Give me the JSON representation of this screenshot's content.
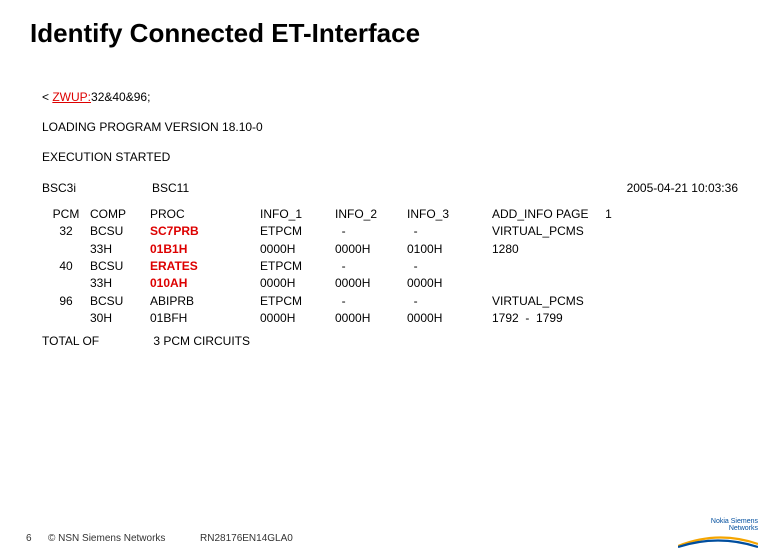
{
  "title": "Identify Connected ET-Interface",
  "cmd": {
    "prefix": "< ",
    "zwup": "ZWUP:",
    "args": "32&40&96;"
  },
  "line_loading": "LOADING PROGRAM VERSION 18.10-0",
  "line_exec": "EXECUTION STARTED",
  "meta": {
    "bsc3i": "BSC3i",
    "bsc11": "BSC11",
    "timestamp": "2005-04-21  10:03:36"
  },
  "headers": {
    "pcm": "PCM",
    "comp": "COMP",
    "proc": "PROC",
    "info1": "INFO_1",
    "info2": "INFO_2",
    "info3": "INFO_3",
    "addinfo": "ADD_INFO PAGE",
    "page_no": "1"
  },
  "rows": [
    {
      "pcm": "32",
      "comp": [
        "BCSU",
        "33H"
      ],
      "proc": [
        "SC7PRB",
        "01B1H"
      ],
      "proc_hl": true,
      "info1": [
        "ETPCM",
        "0000H"
      ],
      "info2": [
        "-",
        "0000H"
      ],
      "info3": [
        "-",
        "0100H"
      ],
      "addinfo": [
        "VIRTUAL_PCMS",
        "1280"
      ]
    },
    {
      "pcm": "40",
      "comp": [
        "BCSU",
        "33H"
      ],
      "proc": [
        "ERATES",
        "010AH"
      ],
      "proc_hl": true,
      "info1": [
        "ETPCM",
        "0000H"
      ],
      "info2": [
        "-",
        "0000H"
      ],
      "info3": [
        "-",
        "0000H"
      ],
      "addinfo": [
        "",
        ""
      ]
    },
    {
      "pcm": "96",
      "comp": [
        "BCSU",
        "30H"
      ],
      "proc": [
        "ABIPRB",
        "01BFH"
      ],
      "proc_hl": false,
      "info1": [
        "ETPCM",
        "0000H"
      ],
      "info2": [
        "-",
        "0000H"
      ],
      "info3": [
        "-",
        "0000H"
      ],
      "addinfo": [
        "VIRTUAL_PCMS",
        "1792  -  1799"
      ]
    }
  ],
  "total": {
    "label": "TOTAL OF",
    "value": "3 PCM CIRCUITS"
  },
  "footer": {
    "page": "6",
    "copyright": "© NSN Siemens Networks",
    "docid": "RN28176EN14GLA0",
    "logo": "Nokia Siemens\nNetworks"
  }
}
